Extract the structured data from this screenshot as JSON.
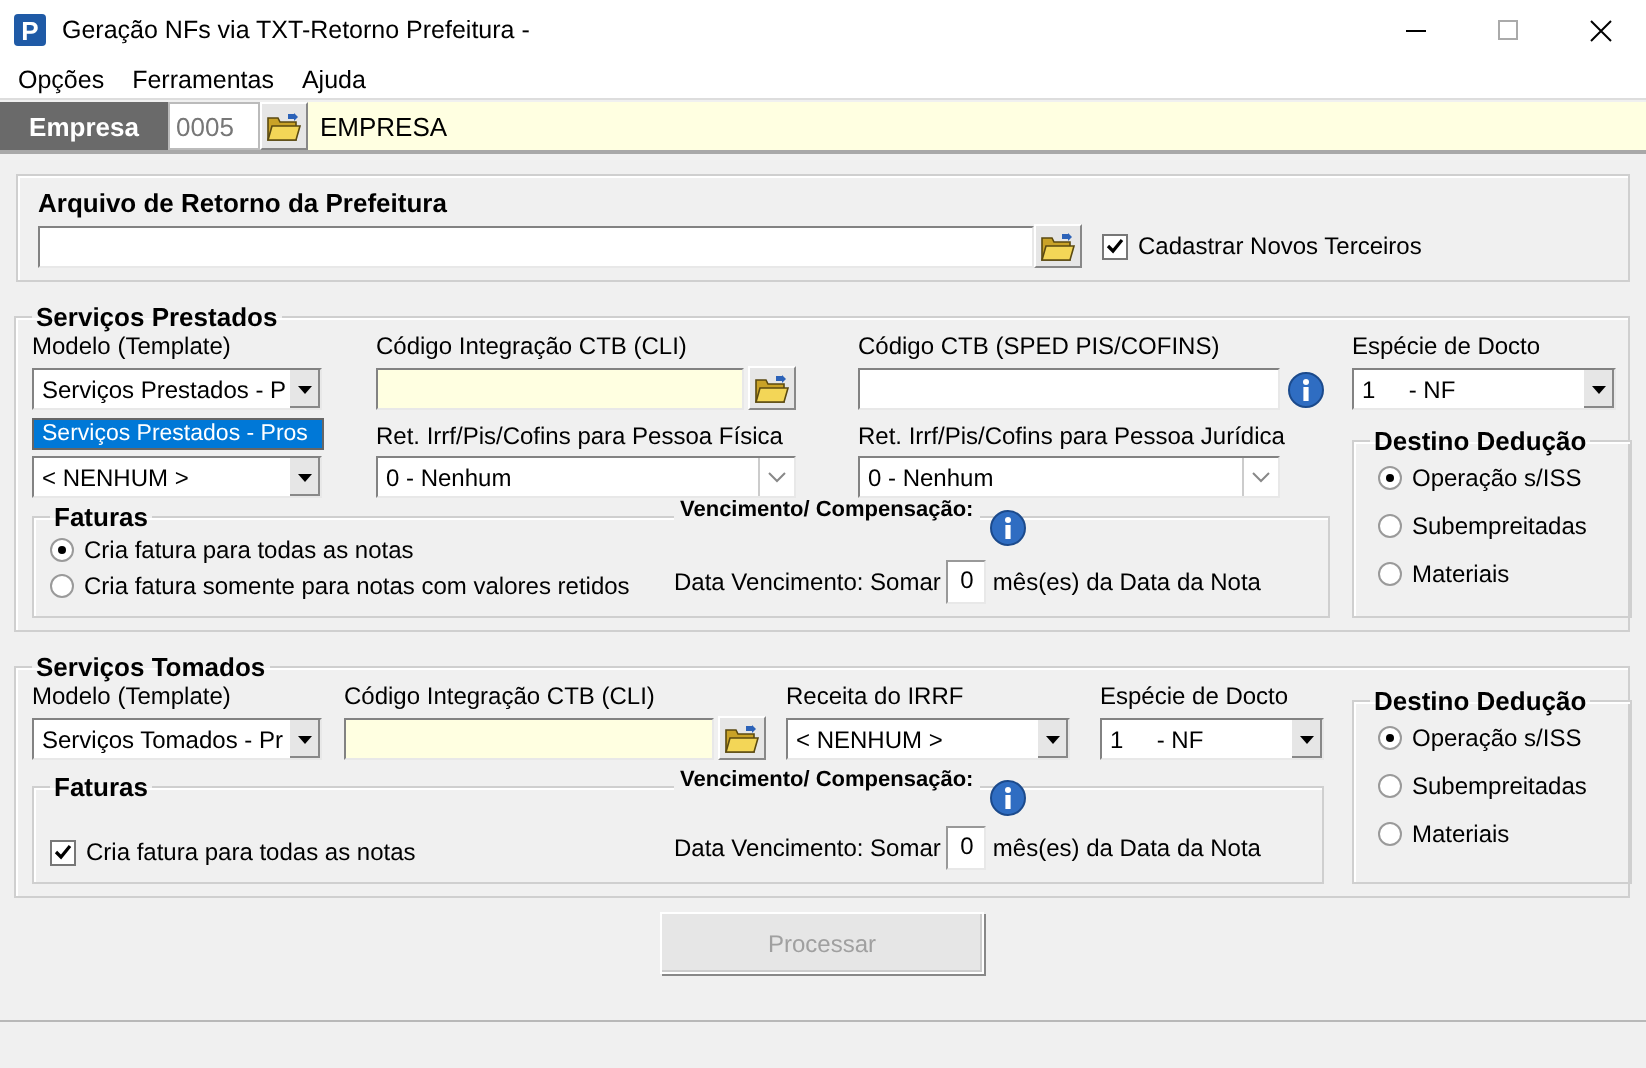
{
  "window": {
    "logo": "P",
    "title": "Geração NFs via TXT-Retorno Prefeitura -"
  },
  "menu": [
    "Opções",
    "Ferramentas",
    "Ajuda"
  ],
  "empresa": {
    "label": "Empresa",
    "code": "0005",
    "name": "EMPRESA"
  },
  "arquivo": {
    "title": "Arquivo de Retorno da Prefeitura",
    "cadastrar": {
      "label": "Cadastrar Novos Terceiros",
      "checked": true
    }
  },
  "prestados": {
    "title": "Serviços Prestados",
    "modelo": {
      "label": "Modelo (Template)",
      "value": "Serviços Prestados - P",
      "open_option": "Serviços Prestados - Pros"
    },
    "codigo_cli": {
      "label": "Código Integração CTB (CLI)"
    },
    "codigo_sped": {
      "label": "Código CTB (SPED PIS/COFINS)"
    },
    "especie": {
      "label": "Espécie de Docto",
      "value": "1     - NF"
    },
    "receita": {
      "value": "< NENHUM >"
    },
    "ret_pf": {
      "label": "Ret. Irrf/Pis/Cofins para Pessoa Física",
      "value": "0 - Nenhum"
    },
    "ret_pj": {
      "label": "Ret. Irrf/Pis/Cofins para Pessoa Jurídica",
      "value": "0 - Nenhum"
    },
    "faturas": {
      "title": "Faturas",
      "kind": "radio",
      "options": [
        {
          "label": "Cria fatura para todas as notas",
          "selected": true
        },
        {
          "label": "Cria fatura somente para notas com valores retidos",
          "selected": false
        }
      ]
    },
    "vencimento": {
      "title": "Vencimento/ Compensação:",
      "prefix": "Data Vencimento: Somar",
      "months": "0",
      "suffix": "mês(es) da Data da Nota"
    },
    "destino": {
      "title": "Destino Dedução",
      "options": [
        {
          "label": "Operação s/ISS",
          "selected": true
        },
        {
          "label": "Subempreitadas",
          "selected": false
        },
        {
          "label": "Materiais",
          "selected": false
        }
      ]
    }
  },
  "tomados": {
    "title": "Serviços Tomados",
    "modelo": {
      "label": "Modelo (Template)",
      "value": "Serviços Tomados - Pr"
    },
    "codigo_cli": {
      "label": "Código Integração CTB (CLI)"
    },
    "receita": {
      "label": "Receita do IRRF",
      "value": "< NENHUM >"
    },
    "especie": {
      "label": "Espécie de Docto",
      "value": "1     - NF"
    },
    "faturas": {
      "title": "Faturas",
      "kind": "checkbox",
      "options": [
        {
          "label": "Cria fatura para todas as notas",
          "checked": true
        }
      ]
    },
    "vencimento": {
      "title": "Vencimento/ Compensação:",
      "prefix": "Data Vencimento: Somar",
      "months": "0",
      "suffix": "mês(es) da Data da Nota"
    },
    "destino": {
      "title": "Destino Dedução",
      "options": [
        {
          "label": "Operação s/ISS",
          "selected": true
        },
        {
          "label": "Subempreitadas",
          "selected": false
        },
        {
          "label": "Materiais",
          "selected": false
        }
      ]
    }
  },
  "process_button": {
    "label": "Processar",
    "disabled": true
  }
}
